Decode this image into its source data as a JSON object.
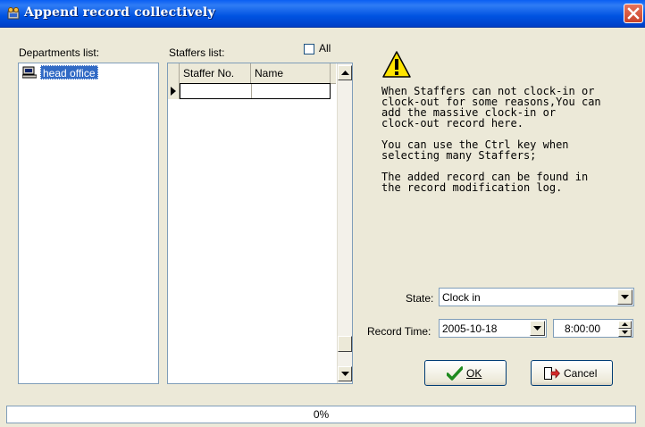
{
  "window": {
    "title": "Append record collectively"
  },
  "departments": {
    "label": "Departments list:",
    "items": [
      "head office"
    ]
  },
  "staffers": {
    "label": "Staffers list:",
    "all_label": "All",
    "all_checked": false,
    "columns": [
      "Staffer No.",
      "Name"
    ]
  },
  "info": {
    "lines": [
      "When Staffers can not clock-in or\nclock-out for some reasons,You can\nadd the massive clock-in or\nclock-out record here.",
      "You can use the Ctrl key when\nselecting many Staffers;",
      "The added record can be found in\nthe record modification log."
    ]
  },
  "form": {
    "state_label": "State:",
    "state_value": "Clock in",
    "time_label": "Record Time:",
    "date_value": "2005-10-18",
    "time_value": "8:00:00"
  },
  "buttons": {
    "ok": "OK",
    "cancel": "Cancel"
  },
  "status": {
    "progress_text": "0%",
    "progress_value": 0
  },
  "colors": {
    "title_bar": "#0a5ef3",
    "selection": "#316ac5",
    "face": "#ece9d8",
    "close": "#e8735b"
  }
}
